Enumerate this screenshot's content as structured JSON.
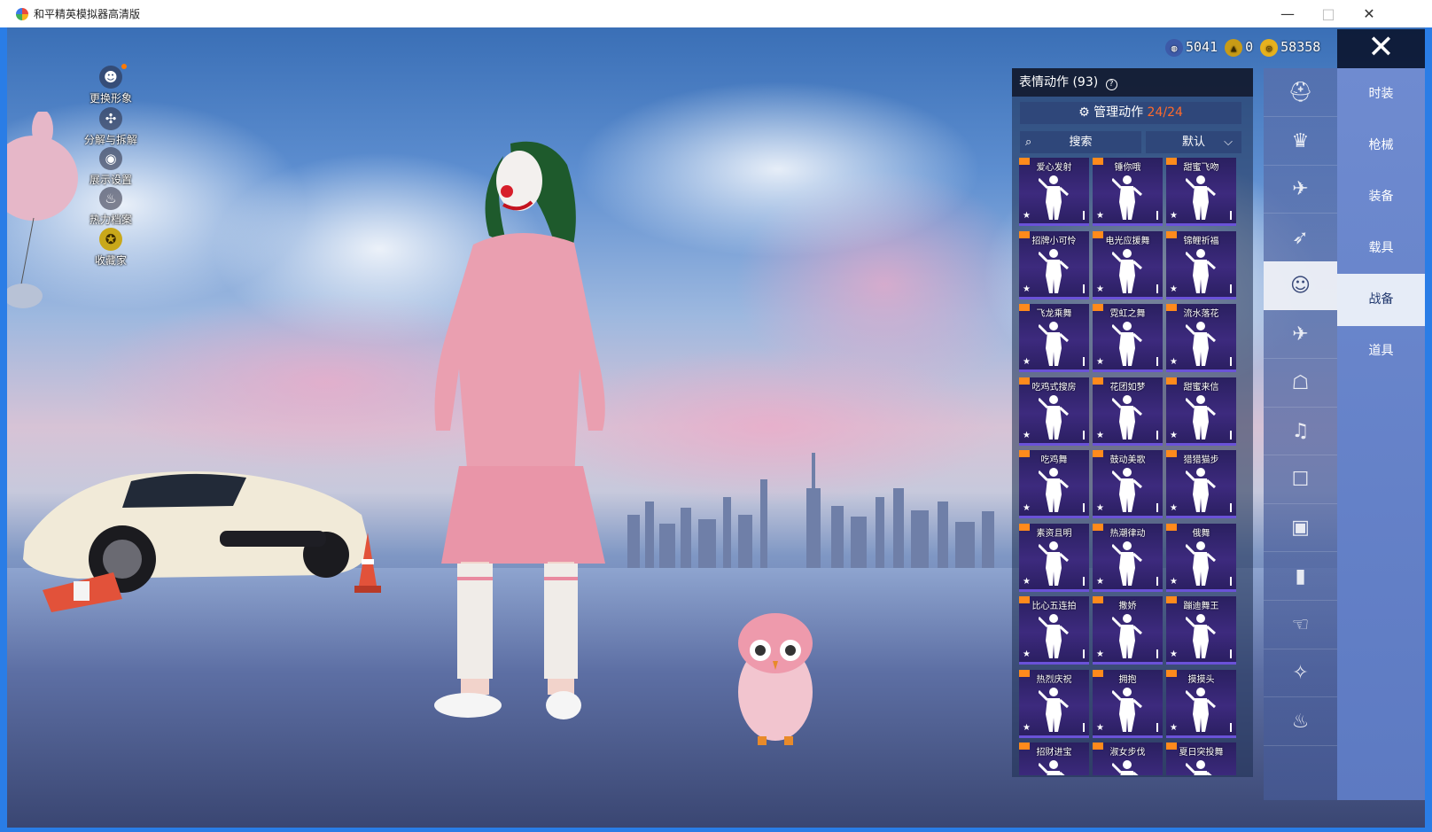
{
  "window": {
    "title": "和平精英模拟器高清版",
    "minimize": "—",
    "maximize": "□",
    "close": "✕"
  },
  "left_menu": [
    {
      "label": "更换形象",
      "icon": "person-icon",
      "glyph": "☻"
    },
    {
      "label": "分解与拆解",
      "icon": "puzzle-icon",
      "glyph": "✣"
    },
    {
      "label": "展示设置",
      "icon": "eye-icon",
      "glyph": "◉"
    },
    {
      "label": "热力档案",
      "icon": "flame-icon",
      "glyph": "♨"
    },
    {
      "label": "收藏家",
      "icon": "badge-icon",
      "glyph": "✪"
    }
  ],
  "currency": [
    {
      "value": "5041",
      "icon": "globe-coin-icon",
      "color": "#3d5aa8",
      "glyph": "◍"
    },
    {
      "value": "0",
      "icon": "triangle-coin-icon",
      "color": "#c89b16",
      "glyph": "▲"
    },
    {
      "value": "58358",
      "icon": "gold-coin-icon",
      "color": "#e6b11d",
      "glyph": "◎"
    }
  ],
  "close_glyph": "✕",
  "panel": {
    "title": "表情动作 (93)",
    "help": "?",
    "manage_label": "管理动作",
    "manage_count": "24/24",
    "search_label": "搜索",
    "sort_label": "默认",
    "sort_arrow": "⌵"
  },
  "emotes": [
    [
      "爱心发射",
      "锤你哦",
      "甜蜜飞吻"
    ],
    [
      "招牌小可怜",
      "电光应援舞",
      "锦鲤祈福"
    ],
    [
      "飞龙乘舞",
      "霓虹之舞",
      "流水落花"
    ],
    [
      "吃鸡式搜房",
      "花团如梦",
      "甜蜜来信"
    ],
    [
      "吃鸡舞",
      "鼓动美歌",
      "猎猎猫步"
    ],
    [
      "素资且明",
      "热潮律动",
      "俄舞"
    ],
    [
      "比心五连拍",
      "撒娇",
      "蹦迪舞王"
    ],
    [
      "热烈庆祝",
      "拥抱",
      "摸摸头"
    ],
    [
      "招财进宝",
      "淑女步伐",
      "夏日突投舞"
    ]
  ],
  "emote_star": "★",
  "categories": [
    {
      "icon": "hat-icon",
      "glyph": "⛑"
    },
    {
      "icon": "crown-icon",
      "glyph": "♛"
    },
    {
      "icon": "drone-icon",
      "glyph": "✈"
    },
    {
      "icon": "glider-icon",
      "glyph": "➶"
    },
    {
      "icon": "smile-icon",
      "glyph": "☺"
    },
    {
      "icon": "plane-icon",
      "glyph": "✈"
    },
    {
      "icon": "robot-icon",
      "glyph": "☖"
    },
    {
      "icon": "speaker-icon",
      "glyph": "♫"
    },
    {
      "icon": "chat-icon",
      "glyph": "☐"
    },
    {
      "icon": "photo-icon",
      "glyph": "▣"
    },
    {
      "icon": "extinguisher-icon",
      "glyph": "▮"
    },
    {
      "icon": "hand-icon",
      "glyph": "☜"
    },
    {
      "icon": "wand-icon",
      "glyph": "✧"
    },
    {
      "icon": "turkey-icon",
      "glyph": "♨"
    }
  ],
  "active_category": 4,
  "tabs": [
    "时装",
    "枪械",
    "装备",
    "载具",
    "战备",
    "道具"
  ],
  "active_tab": 4
}
